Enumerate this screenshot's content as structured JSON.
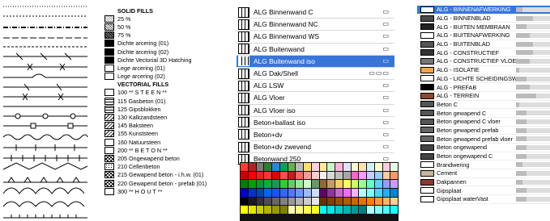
{
  "fills_panel": {
    "solid_header": "SOLID FILLS",
    "solid_fills": [
      {
        "label": "25 %",
        "swatch": "light"
      },
      {
        "label": "50 %",
        "swatch": "mid"
      },
      {
        "label": "75 %",
        "swatch": "dark"
      },
      {
        "label": "Dichte arcering (01)",
        "swatch": "solid"
      },
      {
        "label": "Dichte arcering (02)",
        "swatch": "solid"
      },
      {
        "label": "Dichte Vectorial 3D Hatching",
        "swatch": "solid"
      },
      {
        "label": "Lege arcering (01)",
        "swatch": "empty"
      },
      {
        "label": "Lege arcering (02)",
        "swatch": "empty"
      }
    ],
    "vectorial_header": "VECTORIAL FILLS",
    "vectorial_fills": [
      {
        "label": "100 ** S T E E N **",
        "swatch": "empty"
      },
      {
        "label": "115 Gasbeton (01)",
        "swatch": "brick"
      },
      {
        "label": "125 Gipsblokken",
        "swatch": "brick"
      },
      {
        "label": "130 Kalkzandsteen",
        "swatch": "diag"
      },
      {
        "label": "145 Baksteen",
        "swatch": "diag"
      },
      {
        "label": "155 Kunststeen",
        "swatch": "diag"
      },
      {
        "label": "160 Natuursteen",
        "swatch": "empty"
      },
      {
        "label": "200 ** B E T O N **",
        "swatch": "empty"
      },
      {
        "label": "205 Ongewapend beton",
        "swatch": "cross"
      },
      {
        "label": "210 Cellenbeton",
        "swatch": "dots"
      },
      {
        "label": "215 Gewapend beton - i.h.w. (01)",
        "swatch": "cross"
      },
      {
        "label": "220 Gewapend beton - prefab (01)",
        "swatch": "cross"
      },
      {
        "label": "300 ** H O U T **",
        "swatch": "empty"
      }
    ]
  },
  "composites_panel": {
    "items": [
      {
        "label": "ALG Binnenwand C",
        "tags": "▭",
        "selected": false
      },
      {
        "label": "ALG Binnenwand NC",
        "tags": "▭",
        "selected": false
      },
      {
        "label": "ALG Binnenwand WS",
        "tags": "▭",
        "selected": false
      },
      {
        "label": "ALG Buitenwand",
        "tags": "▭",
        "selected": false
      },
      {
        "label": "ALG Buitenwand iso",
        "tags": "▭",
        "selected": true
      },
      {
        "label": "ALG Dak/Shell",
        "tags": "▭▭▭",
        "selected": false
      },
      {
        "label": "ALG LSW",
        "tags": "▭",
        "selected": false
      },
      {
        "label": "ALG Vloer",
        "tags": "▭",
        "selected": false
      },
      {
        "label": "ALG Vloer iso",
        "tags": "▭",
        "selected": false
      },
      {
        "label": "Beton+ballast iso",
        "tags": "▭",
        "selected": false
      },
      {
        "label": "Beton+dv",
        "tags": "▭",
        "selected": false
      },
      {
        "label": "Beton+dv zwevend",
        "tags": "▭",
        "selected": false
      },
      {
        "label": "Betonwand 250",
        "tags": "▭",
        "selected": false
      }
    ]
  },
  "palette": {
    "colors": [
      "#ff3b30",
      "#b22222",
      "#7a7a7a",
      "#2e7d32",
      "#1e88e5",
      "#00a651",
      "#6ab04c",
      "#bcbcbc",
      "#ffe066",
      "#ffd1dc",
      "#ffeb99",
      "#c8f7c5",
      "#ffb3d9",
      "#e0e0ff",
      "#fff5cc",
      "#ffe0b3",
      "#d1f0ff",
      "#ffffcc",
      "#ffcce0",
      "#e6ffe6",
      "#cc0000",
      "#ff0000",
      "#ff1a1a",
      "#ff3333",
      "#e60000",
      "#ff4d4d",
      "#cc1a1a",
      "#ff6666",
      "#ff9999",
      "#ffcccc",
      "#f2f2f2",
      "#d9d9d9",
      "#bfbfbf",
      "#a6a6a6",
      "#ff66cc",
      "#ff99ff",
      "#ccccff",
      "#99ccff",
      "#ffcc99",
      "#ff9966",
      "#008000",
      "#00a000",
      "#009933",
      "#00b33c",
      "#1a9950",
      "#33cc33",
      "#66cc66",
      "#99e699",
      "#ccffcc",
      "#669966",
      "#996633",
      "#cc9966",
      "#ffcc66",
      "#ffff66",
      "#ccff66",
      "#99ff99",
      "#66ffcc",
      "#66ccff",
      "#9999ff",
      "#cc99ff",
      "#0000cc",
      "#0033cc",
      "#0047b3",
      "#0066ff",
      "#1a53ff",
      "#3366ff",
      "#4d79ff",
      "#6699ff",
      "#99bbff",
      "#ccddff",
      "#660066",
      "#993399",
      "#cc66cc",
      "#ff66ff",
      "#ffb3ff",
      "#b3ffff",
      "#80ffff",
      "#4dd2ff",
      "#1ab2ff",
      "#0088cc",
      "#000000",
      "#1a1a1a",
      "#333333",
      "#4d4d4d",
      "#666666",
      "#808080",
      "#999999",
      "#b3b3b3",
      "#cccccc",
      "#e6e6e6",
      "#663300",
      "#804000",
      "#994d00",
      "#b35900",
      "#cc6600",
      "#e67300",
      "#ff8000",
      "#ff9933",
      "#ffb366",
      "#ffcc99",
      "#ffff00",
      "#e6e600",
      "#cccc00",
      "#b3b300",
      "#999900",
      "#808000",
      "#ffffb3",
      "#ffff80",
      "#ffff4d",
      "#ffff1a",
      "#00ffff",
      "#00e6e6",
      "#00cccc",
      "#00b3b3",
      "#009999",
      "#008080",
      "#b3ffff",
      "#80ffff",
      "#4dffff",
      "#1affff"
    ]
  },
  "materials_panel": {
    "items": [
      {
        "label": "ALG - BINNENAFWERKING",
        "color": "#ffffff",
        "fill": 0.2,
        "selected": true
      },
      {
        "label": "ALG - BINNENBLAD",
        "color": "#4a4a4a",
        "fill": 0.5,
        "selected": false
      },
      {
        "label": "ALG - BUITEN MEMBRAAN",
        "color": "#222222",
        "fill": 0.3,
        "selected": false
      },
      {
        "label": "ALG - BUITENAFWERKING",
        "color": "#ffffff",
        "fill": 0.4,
        "selected": false
      },
      {
        "label": "ALG - BUITENBLAD",
        "color": "#555555",
        "fill": 0.5,
        "selected": false
      },
      {
        "label": "ALG - CONSTRUCTIEF",
        "color": "#333333",
        "fill": 0.5,
        "selected": false
      },
      {
        "label": "ALG - CONSTRUCTIEF VLOER",
        "color": "#777777",
        "fill": 0.4,
        "selected": false
      },
      {
        "label": "ALG - ISOLATIE",
        "color": "#f2a640",
        "fill": 0.1,
        "selected": false
      },
      {
        "label": "ALG - LICHTE SCHEIDINGSWAND",
        "color": "#ffffff",
        "fill": 0.3,
        "selected": false
      },
      {
        "label": "ALG - PREFAB",
        "color": "#000000",
        "fill": 0.4,
        "selected": false
      },
      {
        "label": "ALG - TERREIN",
        "color": "#8b4a2b",
        "fill": 0.6,
        "selected": false
      },
      {
        "label": "Beton C",
        "color": "#555555",
        "fill": 0.1,
        "selected": false
      },
      {
        "label": "Beton gewapend C",
        "color": "#555555",
        "fill": 0.3,
        "selected": false
      },
      {
        "label": "Beton gewapend C vloer",
        "color": "#555555",
        "fill": 0.3,
        "selected": false
      },
      {
        "label": "Beton gewapend prefab",
        "color": "#666666",
        "fill": 0.3,
        "selected": false
      },
      {
        "label": "Beton gewapend prefab vloer",
        "color": "#666666",
        "fill": 0.3,
        "selected": false
      },
      {
        "label": "Beton ongewapend",
        "color": "#444444",
        "fill": 0.3,
        "selected": false
      },
      {
        "label": "Beton ongewapend C",
        "color": "#444444",
        "fill": 0.3,
        "selected": false
      },
      {
        "label": "Brandwering",
        "color": "#ffffff",
        "fill": 0.2,
        "selected": false
      },
      {
        "label": "Cement",
        "color": "#c5b8a0",
        "fill": 0.3,
        "selected": false
      },
      {
        "label": "Dakpannen",
        "color": "#8b3a2b",
        "fill": 0.2,
        "selected": false
      },
      {
        "label": "Gipsplaat",
        "color": "#ffffff",
        "fill": 0.3,
        "selected": false
      },
      {
        "label": "Gipsplaat waterVast",
        "color": "#ffffff",
        "fill": 0.3,
        "selected": false
      }
    ]
  }
}
